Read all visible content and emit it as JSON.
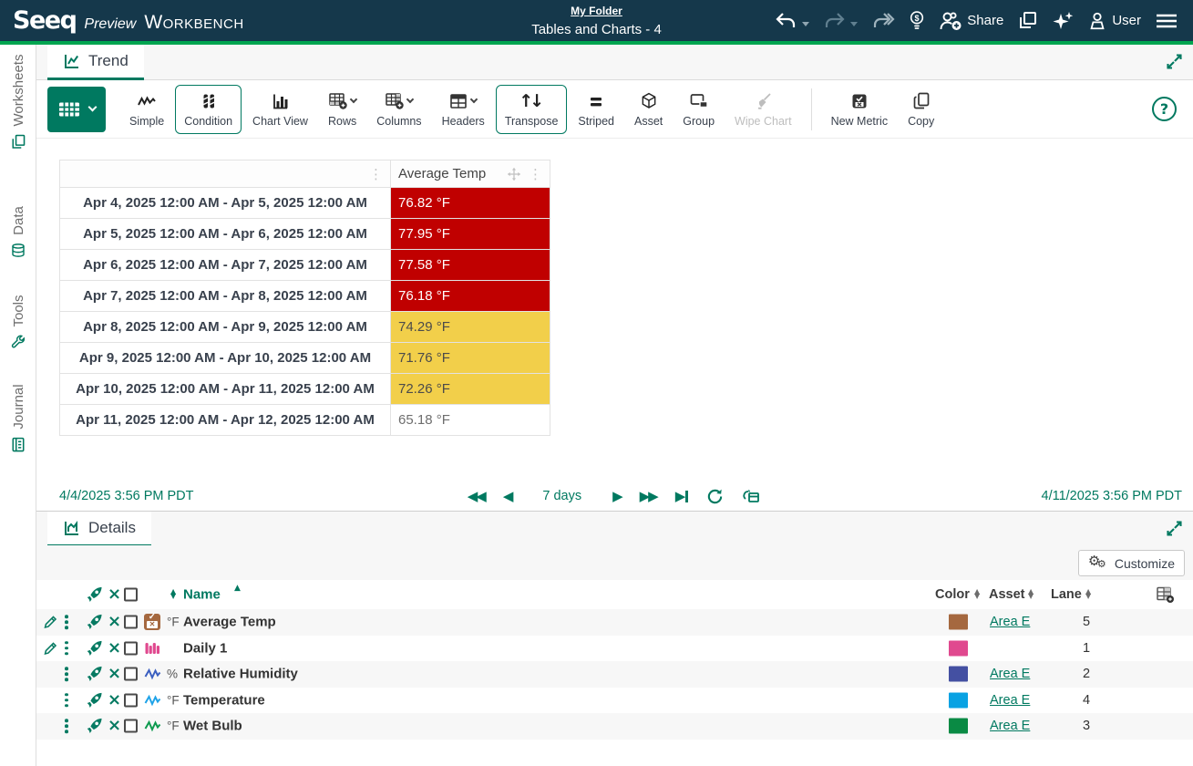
{
  "colors": {
    "brand_teal": "#007960",
    "header_bg": "#15384b",
    "accent_green": "#00a550",
    "alert_red": "#c00000",
    "warn_yellow": "#f2cf4a"
  },
  "icons": {
    "close": "×",
    "dots_menu": "⋮",
    "transpose": "↑↓",
    "help": "?",
    "step_back_many": "◀◀",
    "step_back": "◀",
    "step_forward": "▶",
    "step_forward_many": "▶▶",
    "sort_up": "▲",
    "sort_down": "▼",
    "gear": "⚙"
  },
  "header": {
    "logo_seeq": "Seeq",
    "logo_preview": "Preview",
    "logo_workbench": "Workbench",
    "breadcrumb": "My Folder",
    "worksheet_title": "Tables and Charts - 4",
    "share_label": "Share",
    "user_label": "User"
  },
  "sidebar": {
    "items": [
      {
        "label": "Worksheets"
      },
      {
        "label": "Data"
      },
      {
        "label": "Tools"
      },
      {
        "label": "Journal"
      }
    ]
  },
  "trend": {
    "tab_label": "Trend",
    "toolbar": {
      "simple": "Simple",
      "condition": "Condition",
      "chart_view": "Chart View",
      "rows": "Rows",
      "columns": "Columns",
      "headers": "Headers",
      "transpose": "Transpose",
      "striped": "Striped",
      "asset": "Asset",
      "group": "Group",
      "wipe_chart": "Wipe Chart",
      "new_metric": "New Metric",
      "copy": "Copy"
    },
    "table": {
      "value_column": "Average Temp",
      "rows": [
        {
          "range": "Apr 4, 2025 12:00 AM - Apr 5, 2025 12:00 AM",
          "value": "76.82 °F",
          "status": "alert"
        },
        {
          "range": "Apr 5, 2025 12:00 AM - Apr 6, 2025 12:00 AM",
          "value": "77.95 °F",
          "status": "alert"
        },
        {
          "range": "Apr 6, 2025 12:00 AM - Apr 7, 2025 12:00 AM",
          "value": "77.58 °F",
          "status": "alert"
        },
        {
          "range": "Apr 7, 2025 12:00 AM - Apr 8, 2025 12:00 AM",
          "value": "76.18 °F",
          "status": "alert"
        },
        {
          "range": "Apr 8, 2025 12:00 AM - Apr 9, 2025 12:00 AM",
          "value": "74.29 °F",
          "status": "warn"
        },
        {
          "range": "Apr 9, 2025 12:00 AM - Apr 10, 2025 12:00 AM",
          "value": "71.76 °F",
          "status": "warn"
        },
        {
          "range": "Apr 10, 2025 12:00 AM - Apr 11, 2025 12:00 AM",
          "value": "72.26 °F",
          "status": "warn"
        },
        {
          "range": "Apr 11, 2025 12:00 AM - Apr 12, 2025 12:00 AM",
          "value": "65.18 °F",
          "status": "none"
        }
      ]
    },
    "time_bar": {
      "start": "4/4/2025 3:56 PM  PDT",
      "duration": "7 days",
      "end": "4/11/2025 3:56 PM  PDT"
    }
  },
  "details": {
    "tab_label": "Details",
    "customize_label": "Customize",
    "columns": {
      "name": "Name",
      "color": "Color",
      "asset": "Asset",
      "lane": "Lane"
    },
    "rows": [
      {
        "type": "metric",
        "unit": "°F",
        "name": "Average Temp",
        "color": "#a5683f",
        "icon_color": "#a5683f",
        "asset": "Area E",
        "lane": "5"
      },
      {
        "type": "condition",
        "unit": "",
        "name": "Daily 1",
        "color": "#e0498f",
        "icon_color": "#e0498f",
        "asset": "",
        "lane": "1"
      },
      {
        "type": "signal",
        "unit": "%",
        "name": "Relative Humidity",
        "color": "#4450a2",
        "icon_color": "#3b5fc0",
        "asset": "Area E",
        "lane": "2"
      },
      {
        "type": "signal",
        "unit": "°F",
        "name": "Temperature",
        "color": "#09a2e3",
        "icon_color": "#1fa3e8",
        "asset": "Area E",
        "lane": "4"
      },
      {
        "type": "signal",
        "unit": "°F",
        "name": "Wet Bulb",
        "color": "#0a8a44",
        "icon_color": "#0e9a4f",
        "asset": "Area E",
        "lane": "3"
      }
    ]
  }
}
